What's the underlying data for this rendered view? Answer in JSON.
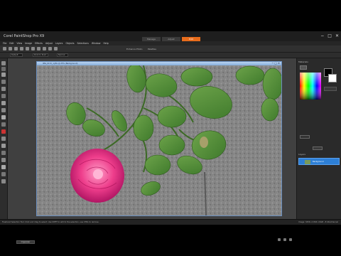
{
  "app": {
    "title": "Corel PaintShop Pro X9",
    "tabs": [
      {
        "label": "Manage",
        "active": false
      },
      {
        "label": "Adjust",
        "active": false
      },
      {
        "label": "Edit",
        "active": true
      }
    ],
    "window_controls": [
      "−",
      "□",
      "✕"
    ]
  },
  "menu": [
    "File",
    "Edit",
    "View",
    "Image",
    "Effects",
    "Adjust",
    "Layers",
    "Objects",
    "Selections",
    "Window",
    "Help"
  ],
  "toolbar": {
    "label_1": "Enhance Photo",
    "label_2": "Palettes"
  },
  "options_bar": {
    "field_1": "Default",
    "field_2": "Point to Point",
    "field_3": "Normal"
  },
  "document": {
    "title": "IMG_0172_1.JPG @ 25% (Background)",
    "controls": [
      "−",
      "□",
      "✕"
    ]
  },
  "right_panel": {
    "materials_head": "Materials",
    "layers_head": "Layers",
    "layer_name": "Raster 1",
    "background_label": "Background"
  },
  "bottom_tab": "Organizer",
  "status": {
    "left": "Freehand Selection Tool: Click and drag to select. Use SHIFT to add to the selection, use CTRL to remove.",
    "right": "Image: 3456 x 2304 x RGB - 8 bits/channel"
  },
  "colors": {
    "accent": "#e76c1c",
    "title_bar": "#1e1e1e",
    "doc_title": "#86aedc",
    "selected_layer": "#2d7fd6"
  }
}
